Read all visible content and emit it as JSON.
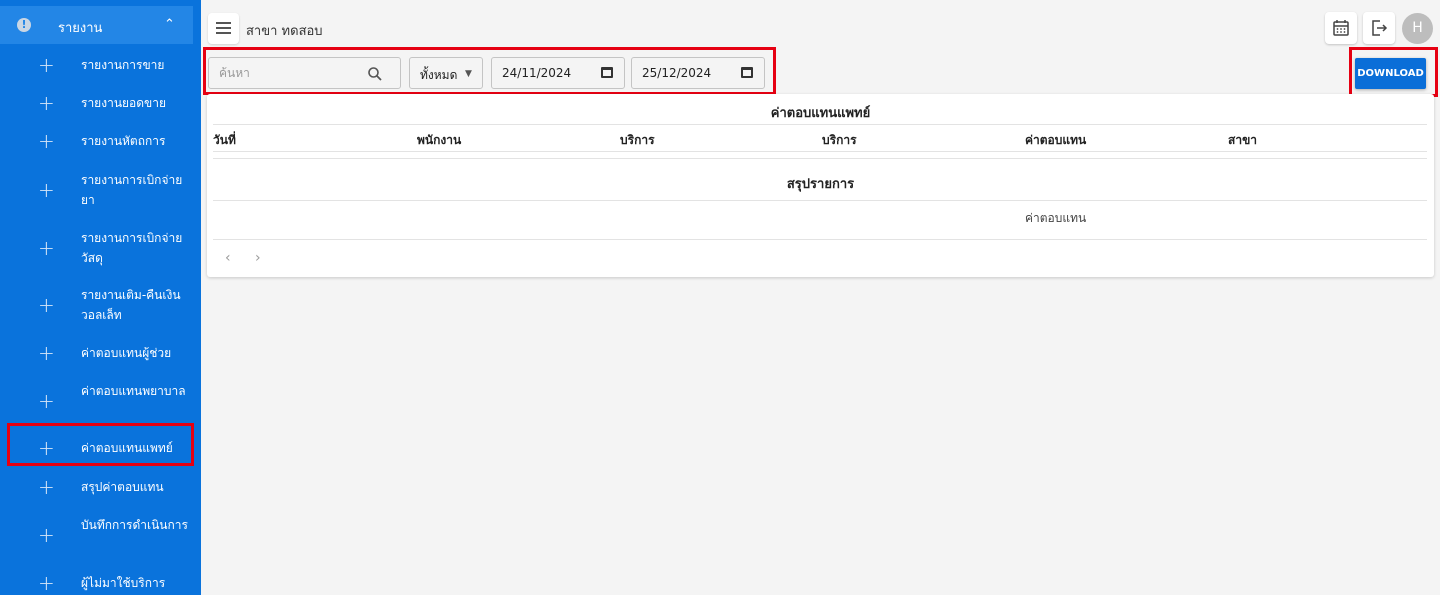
{
  "sidebar": {
    "section_title": "รายงาน",
    "items": [
      {
        "label": "รายงานการขาย"
      },
      {
        "label": "รายงานยอดขาย"
      },
      {
        "label": "รายงานหัตถการ"
      },
      {
        "label": "รายงานการเบิกจ่ายยา"
      },
      {
        "label": "รายงานการเบิกจ่ายวัสดุ"
      },
      {
        "label": "รายงานเติม-คืนเงินวอลเล็ท"
      },
      {
        "label": "ค่าตอบแทนผู้ช่วย"
      },
      {
        "label": "ค่าตอบแทนพยาบาล"
      },
      {
        "label": "ค่าตอบแทนแพทย์"
      },
      {
        "label": "สรุปค่าตอบแทน"
      },
      {
        "label": "บันทึกการดำเนินการ"
      },
      {
        "label": "ผู้ไม่มาใช้บริการ"
      }
    ],
    "active_item": "ค่าตอบแทนแพทย์"
  },
  "header": {
    "branch": "สาขา ทดสอบ",
    "avatar_initial": "H"
  },
  "filters": {
    "search_placeholder": "ค้นหา",
    "type_value": "ทั้งหมด",
    "start_date": "24/11/2024",
    "end_date": "25/12/2024"
  },
  "download_label": "DOWNLOAD",
  "report": {
    "title": "ค่าตอบแทนแพทย์",
    "columns": [
      "วันที่",
      "พนักงาน",
      "บริการ",
      "บริการ",
      "ค่าตอบแทน",
      "สาขา"
    ],
    "summary_title": "สรุปรายการ",
    "summary_column": "ค่าตอบแทน"
  },
  "colors": {
    "sidebar": "#0a73dc",
    "sidebar_header": "#2386e6",
    "highlight": "#e60012",
    "primary_button": "#0a6ed8"
  }
}
